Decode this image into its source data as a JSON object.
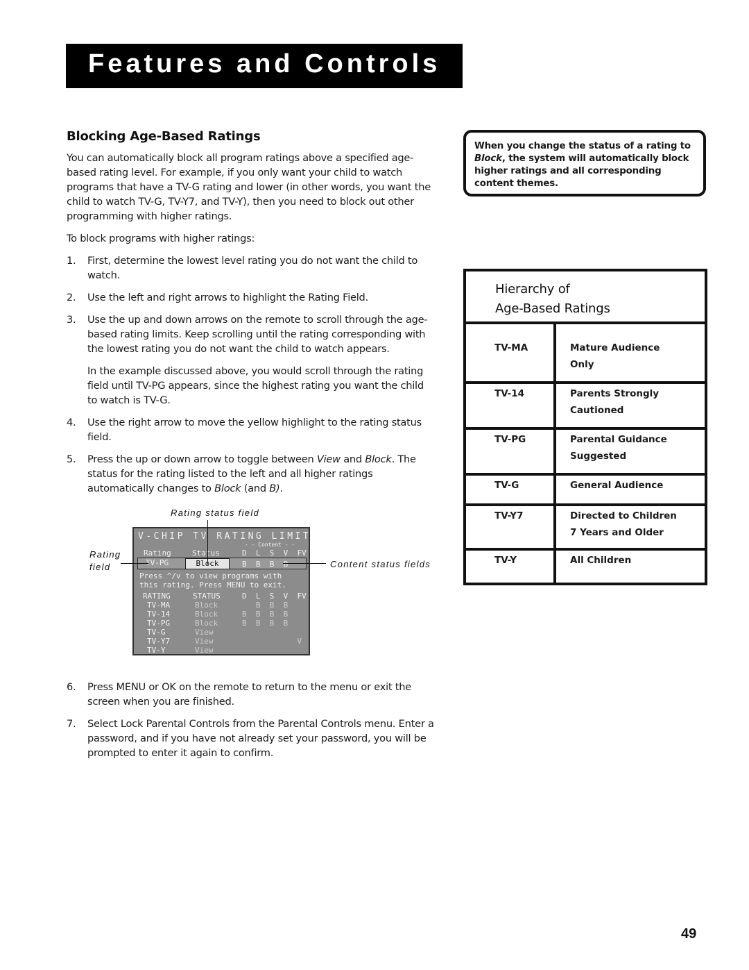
{
  "banner": {
    "title": "Features and Controls"
  },
  "section": {
    "heading": "Blocking Age-Based Ratings",
    "intro": "You can automatically block all program ratings above a specified age-based rating level. For example, if you only want your child to watch programs that have a TV-G rating and lower (in other words, you want the child to watch TV-G, TV-Y7, and TV-Y), then you need to block out other programming with higher ratings.",
    "lead": "To block programs with higher ratings:",
    "steps": [
      {
        "num": "1.",
        "text": "First, determine the lowest level rating you do not want the child to watch."
      },
      {
        "num": "2.",
        "text": "Use the left and right arrows to highlight the Rating Field."
      },
      {
        "num": "3.",
        "text": "Use the up and down arrows on the remote to scroll through the age-based rating limits. Keep scrolling until the rating corresponding with the lowest rating you do not want the child to watch appears.",
        "extra": "In the example discussed above, you would scroll through the rating field until TV-PG appears, since the highest rating you want the child to watch is TV-G."
      },
      {
        "num": "4.",
        "text": "Use the right arrow to move the yellow highlight to the rating status field."
      },
      {
        "num": "5.",
        "text_a": "Press the up or down arrow to toggle between ",
        "em_a": "View",
        "text_b": " and ",
        "em_b": "Block",
        "text_c": ". The status for the rating listed to the left and all higher ratings automatically changes to ",
        "em_c": "Block",
        "text_d": " (and ",
        "em_d": "B)",
        "text_e": "."
      },
      {
        "num": "6.",
        "text": "Press MENU or OK on the remote to return to the menu or exit the screen when you are finished."
      },
      {
        "num": "7.",
        "text": "Select Lock Parental Controls from the Parental Controls menu. Enter a password, and if you have not already set your password, you will be prompted to enter it again to confirm."
      }
    ]
  },
  "diagram": {
    "callouts": {
      "rating_status_field": "Rating status field",
      "rating_field_1": "Rating",
      "rating_field_2": "field",
      "content_status_fields": "Content status fields"
    },
    "osd": {
      "title": "V-CHIP TV RATING LIMIT",
      "content_label": "- - Content - -",
      "header_rating": "Rating",
      "header_status": "Status",
      "header_content": "D  L  S  V  FV",
      "current_rating": "TV-PG",
      "current_status": "Block",
      "current_content": "B  B  B  B",
      "message_1": "Press ^/v to view programs with",
      "message_2": "this rating. Press MENU to exit.",
      "list_header_rating": "RATING",
      "list_header_status": "STATUS",
      "list_header_content": "D  L  S  V  FV",
      "list": [
        {
          "rating": "TV-MA",
          "status": "Block",
          "content": "   B  B  B"
        },
        {
          "rating": "TV-14",
          "status": "Block",
          "content": "B  B  B  B"
        },
        {
          "rating": "TV-PG",
          "status": "Block",
          "content": "B  B  B  B"
        },
        {
          "rating": "TV-G",
          "status": "View",
          "content": ""
        },
        {
          "rating": "TV-Y7",
          "status": "View",
          "content": "            V"
        },
        {
          "rating": "TV-Y",
          "status": "View",
          "content": ""
        }
      ]
    }
  },
  "note": {
    "text_a": "When you change the status of a rating to ",
    "em": "Block",
    "text_b": ", the system will automatically block higher ratings and all corresponding content themes."
  },
  "hierarchy": {
    "title_line1": "Hierarchy of",
    "title_line2": "Age-Based Ratings",
    "rows": [
      {
        "code": "TV-MA",
        "desc1": "Mature Audience",
        "desc2": "Only"
      },
      {
        "code": "TV-14",
        "desc1": "Parents Strongly",
        "desc2": "Cautioned"
      },
      {
        "code": "TV-PG",
        "desc1": "Parental Guidance",
        "desc2": "Suggested"
      },
      {
        "code": "TV-G",
        "desc1": "General Audience",
        "desc2": ""
      },
      {
        "code": "TV-Y7",
        "desc1": "Directed to Children",
        "desc2": "7 Years and Older"
      },
      {
        "code": "TV-Y",
        "desc1": "All Children",
        "desc2": ""
      }
    ]
  },
  "page_number": "49"
}
